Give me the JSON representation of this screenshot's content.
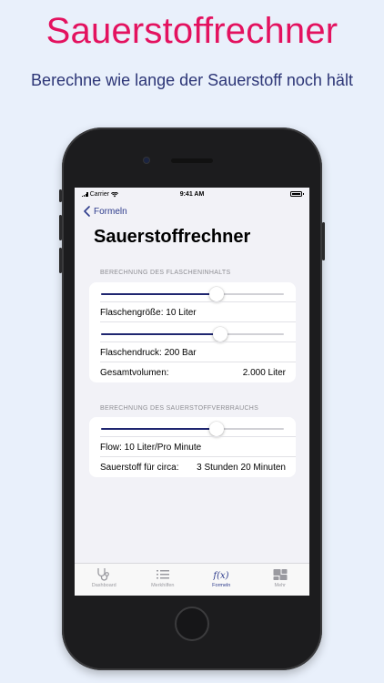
{
  "promo": {
    "headline": "Sauerstoffrechner",
    "subline": "Berechne wie lange der Sauerstoff noch hält"
  },
  "status_bar": {
    "carrier": "Carrier",
    "time": "9:41 AM"
  },
  "nav": {
    "back_label": "Formeln"
  },
  "page": {
    "title": "Sauerstoffrechner"
  },
  "section_content": {
    "header": "BERECHNUNG DES FLASCHENINHALTS",
    "slider_bottle_size_fraction": 0.63,
    "bottle_size_label": "Flaschengröße: 10 Liter",
    "slider_pressure_fraction": 0.65,
    "pressure_label": "Flaschendruck: 200 Bar",
    "total_volume_label": "Gesamtvolumen:",
    "total_volume_value": "2.000 Liter"
  },
  "section_consumption": {
    "header": "BERECHNUNG DES SAUERSTOFFVERBRAUCHS",
    "slider_flow_fraction": 0.63,
    "flow_label": "Flow: 10 Liter/Pro Minute",
    "duration_label": "Sauerstoff für circa:",
    "duration_value": "3 Stunden 20 Minuten"
  },
  "tabbar": {
    "items": [
      {
        "label": "Dashboard",
        "icon": "stethoscope-icon",
        "active": false
      },
      {
        "label": "Merkhilfen",
        "icon": "list-icon",
        "active": false
      },
      {
        "label": "Formeln",
        "icon": "function-icon",
        "glyph": "f(x)",
        "active": true
      },
      {
        "label": "Mehr",
        "icon": "grid-icon",
        "active": false
      }
    ]
  },
  "colors": {
    "headline": "#e3125f",
    "subline": "#2c3576",
    "accent": "#2e3c8c",
    "slider_fill": "#1f2670",
    "background": "#e9f0fb"
  }
}
